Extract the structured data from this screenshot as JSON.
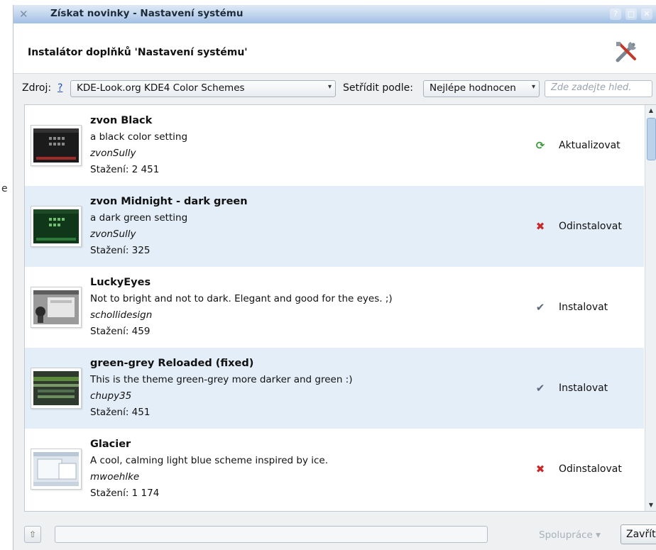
{
  "outside": {
    "fragment": "e"
  },
  "window": {
    "title": "Získat novinky - Nastavení systému",
    "header_title": "Instalátor doplňků 'Nastavení systému'"
  },
  "toolbar": {
    "source_label": "Zdroj:",
    "help": "?",
    "source_value": "KDE-Look.org KDE4 Color Schemes",
    "sort_label": "Setřídit podle:",
    "sort_value": "Nejlépe hodnocen",
    "search_placeholder": "Zde zadejte hled."
  },
  "items": [
    {
      "title": "zvon Black",
      "description": "a black color setting",
      "author": "zvonSully",
      "downloads": "Stažení: 2 451",
      "action": "Aktualizovat",
      "action_icon": "update-icon"
    },
    {
      "title": "zvon Midnight - dark green",
      "description": "a dark green setting",
      "author": "zvonSully",
      "downloads": "Stažení: 325",
      "action": "Odinstalovat",
      "action_icon": "uninstall-icon"
    },
    {
      "title": "LuckyEyes",
      "description": "Not to bright and not to dark. Elegant and good for the eyes. ;)",
      "author": "schollidesign",
      "downloads": "Stažení: 459",
      "action": "Instalovat",
      "action_icon": "install-icon"
    },
    {
      "title": "green-grey Reloaded (fixed)",
      "description": "This is the theme green-grey more darker and green :)",
      "author": "chupy35",
      "downloads": "Stažení: 451",
      "action": "Instalovat",
      "action_icon": "install-icon"
    },
    {
      "title": "Glacier",
      "description": "A cool, calming light blue scheme inspired by ice.",
      "author": "mwoehlke",
      "downloads": "Stažení: 1 174",
      "action": "Odinstalovat",
      "action_icon": "uninstall-icon"
    }
  ],
  "footer": {
    "collaboration": "Spolupráce",
    "close": "Zavřít"
  },
  "colors": {
    "row_alt": "#e4eef8",
    "uninstall": "#c8282a",
    "install": "#5a6a7a",
    "update": "#3f9a3f"
  }
}
